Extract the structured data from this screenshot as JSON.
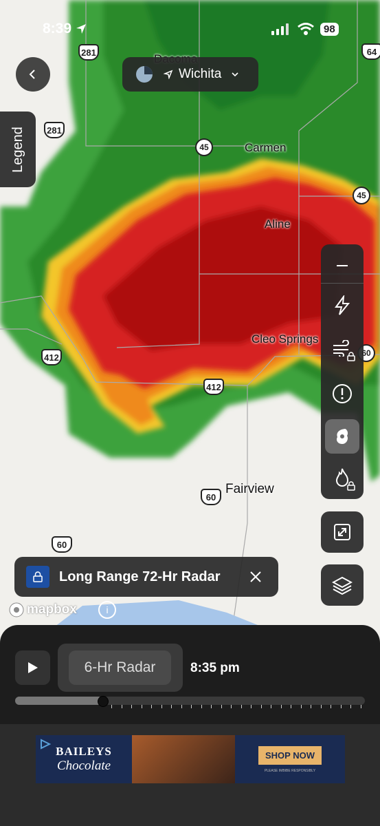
{
  "status_bar": {
    "time": "8:39",
    "battery": "98"
  },
  "location": {
    "name": "Wichita"
  },
  "legend": {
    "label": "Legend"
  },
  "cities": {
    "dacoma": "Dacoma",
    "carmen": "Carmen",
    "aline": "Aline",
    "cleo": "Cleo Springs",
    "fairview": "Fairview"
  },
  "shields": {
    "us281a": "281",
    "us281b": "281",
    "us412a": "412",
    "us412b": "412",
    "us60a": "60",
    "us60b": "60",
    "us64": "64",
    "sh45a": "45",
    "sh45b": "45",
    "sh60": "60"
  },
  "promo": {
    "label": "Long Range 72-Hr Radar"
  },
  "attribution": {
    "label": "mapbox"
  },
  "playback": {
    "mode_label": "6-Hr Radar",
    "time": "8:35 pm",
    "progress": 0.25
  },
  "ad": {
    "brand": "BAILEYS",
    "sub": "Chocolate",
    "cta": "SHOP NOW",
    "fine_print": "PLEASE IMBIBE RESPONSIBLY"
  },
  "colors": {
    "radar_green": "#2e8b2e",
    "radar_red": "#c01818",
    "panel": "#1d1d1d"
  }
}
